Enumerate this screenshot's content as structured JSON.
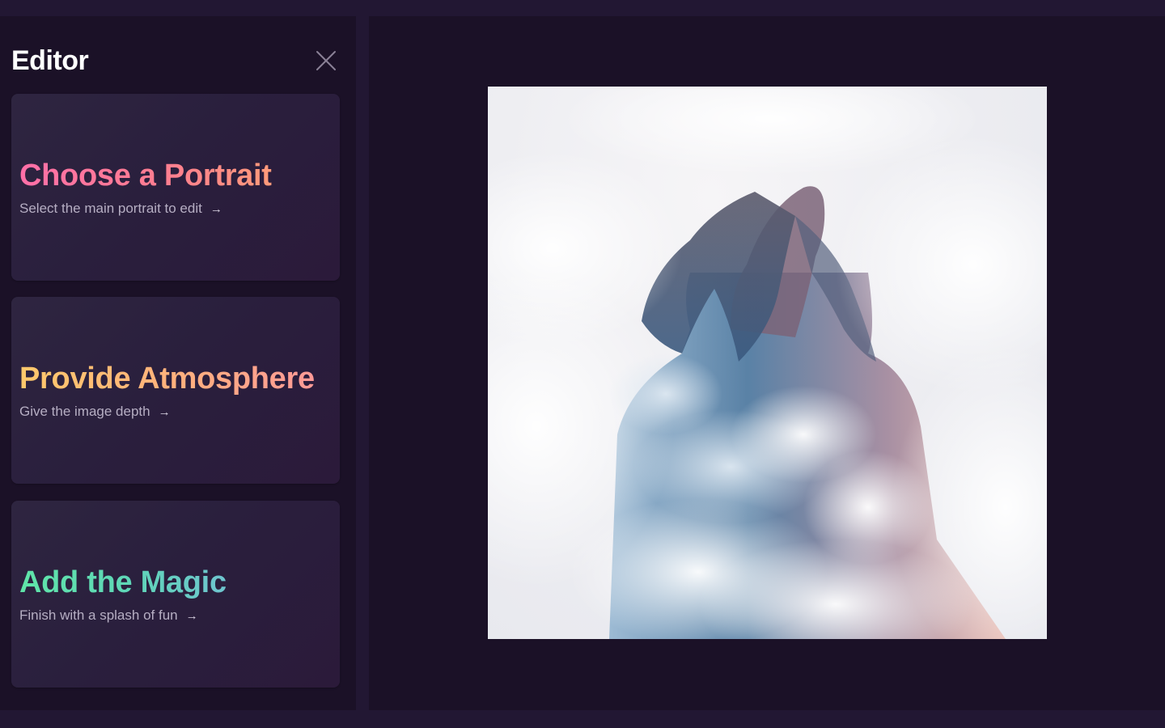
{
  "sidebar": {
    "title": "Editor",
    "close_icon": "close-icon",
    "cards": [
      {
        "title": "Choose a Portrait",
        "subtitle": "Select the main portrait to edit",
        "arrow": "→"
      },
      {
        "title": "Provide Atmosphere",
        "subtitle": "Give the image depth",
        "arrow": "→"
      },
      {
        "title": "Add the Magic",
        "subtitle": "Finish with a splash of fun",
        "arrow": "→"
      }
    ]
  },
  "colors": {
    "background": "#221733",
    "panel": "#1b1127",
    "card": "#2b2140",
    "card1_gradient": [
      "#ff6fa8",
      "#ff9b7a"
    ],
    "card2_gradient": [
      "#ffc96b",
      "#ff9a97"
    ],
    "card3_gradient": [
      "#5fe5a8",
      "#6fc4cf"
    ]
  }
}
